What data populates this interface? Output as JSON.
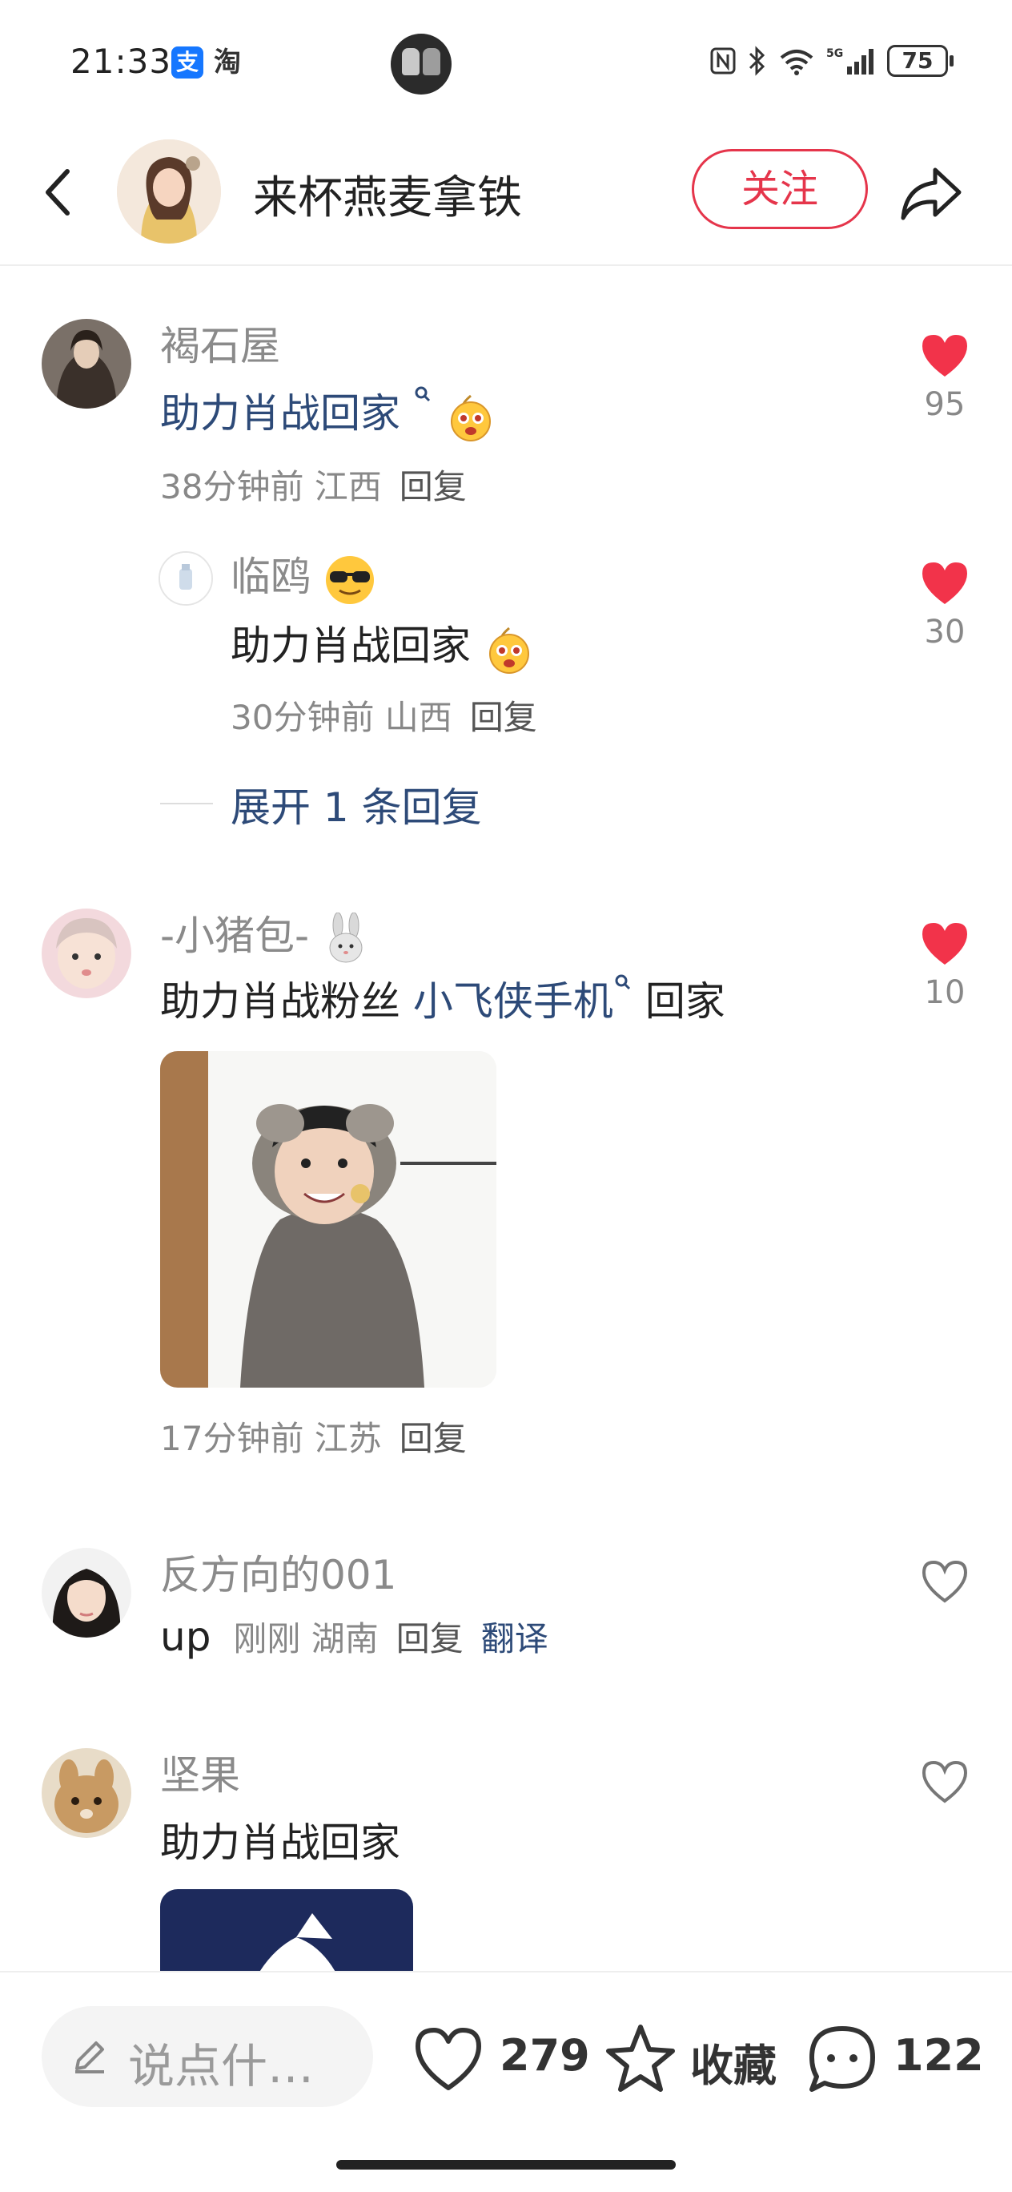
{
  "status_bar": {
    "time": "21:33",
    "app_badges": [
      "支",
      "淘"
    ],
    "battery": "75"
  },
  "header": {
    "author_name": "来杯燕麦拿铁",
    "follow_label": "关注"
  },
  "comments": [
    {
      "name": "褐石屋",
      "text": "助力肖战回家",
      "meta": "38分钟前 江西",
      "reply": "回复",
      "likes": "95",
      "liked": true
    },
    {
      "name": "临鸥",
      "text": "助力肖战回家",
      "meta": "30分钟前 山西",
      "reply": "回复",
      "likes": "30",
      "liked": true
    },
    {
      "name": "-小猪包-",
      "text_prefix": "助力肖战粉丝",
      "text_link": "小飞侠手机",
      "text_suffix": "回家",
      "meta": "17分钟前 江苏",
      "reply": "回复",
      "likes": "10",
      "liked": true
    },
    {
      "name": "反方向的001",
      "text": "up",
      "meta": "刚刚 湖南",
      "reply": "回复",
      "translate": "翻译",
      "liked": false
    },
    {
      "name": "坚果",
      "text": "助力肖战回家",
      "liked": false
    }
  ],
  "expand_replies": "展开 1 条回复",
  "bottom_bar": {
    "input_placeholder": "说点什…",
    "like_count": "279",
    "favorite_label": "收藏",
    "comment_count": "122"
  },
  "colors": {
    "accent_red": "#e5354b",
    "link_blue": "#2d4a78",
    "muted_gray": "#8a8a8a"
  }
}
